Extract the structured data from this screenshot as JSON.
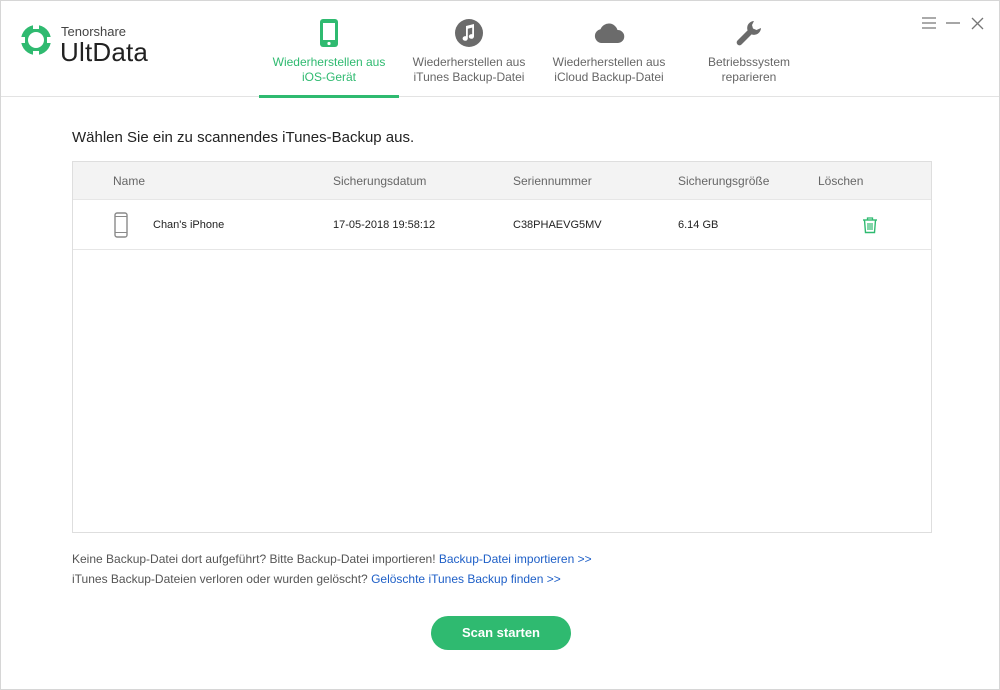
{
  "app": {
    "vendor": "Tenorshare",
    "name": "UltData"
  },
  "nav": {
    "tabs": [
      {
        "line1": "Wiederherstellen aus",
        "line2": "iOS-Gerät",
        "icon": "phone-icon",
        "active": true
      },
      {
        "line1": "Wiederherstellen aus",
        "line2": "iTunes Backup-Datei",
        "icon": "music-note-icon",
        "active": false
      },
      {
        "line1": "Wiederherstellen aus",
        "line2": "iCloud Backup-Datei",
        "icon": "cloud-icon",
        "active": false
      },
      {
        "line1": "Betriebssystem",
        "line2": "reparieren",
        "icon": "wrench-icon",
        "active": false
      }
    ]
  },
  "window_controls": [
    "menu-icon",
    "minimize-icon",
    "close-icon"
  ],
  "main": {
    "prompt": "Wählen Sie ein zu scannendes iTunes-Backup aus.",
    "table": {
      "headers": {
        "name": "Name",
        "date": "Sicherungsdatum",
        "serial": "Seriennummer",
        "size": "Sicherungsgröße",
        "delete": "Löschen"
      },
      "rows": [
        {
          "name": "Chan's iPhone",
          "date": "17-05-2018 19:58:12",
          "serial": "C38PHAEVG5MV",
          "size": "6.14 GB"
        }
      ]
    },
    "hint1": {
      "text": "Keine Backup-Datei dort aufgeführt? Bitte Backup-Datei importieren!",
      "link": "Backup-Datei importieren >>"
    },
    "hint2": {
      "text": "iTunes Backup-Dateien verloren oder wurden gelöscht?",
      "link": "Gelöschte iTunes Backup finden >>"
    },
    "scan_button": "Scan starten"
  },
  "colors": {
    "accent": "#2fba70",
    "link": "#1e5fc7",
    "icon_gray": "#6b6b6b"
  }
}
